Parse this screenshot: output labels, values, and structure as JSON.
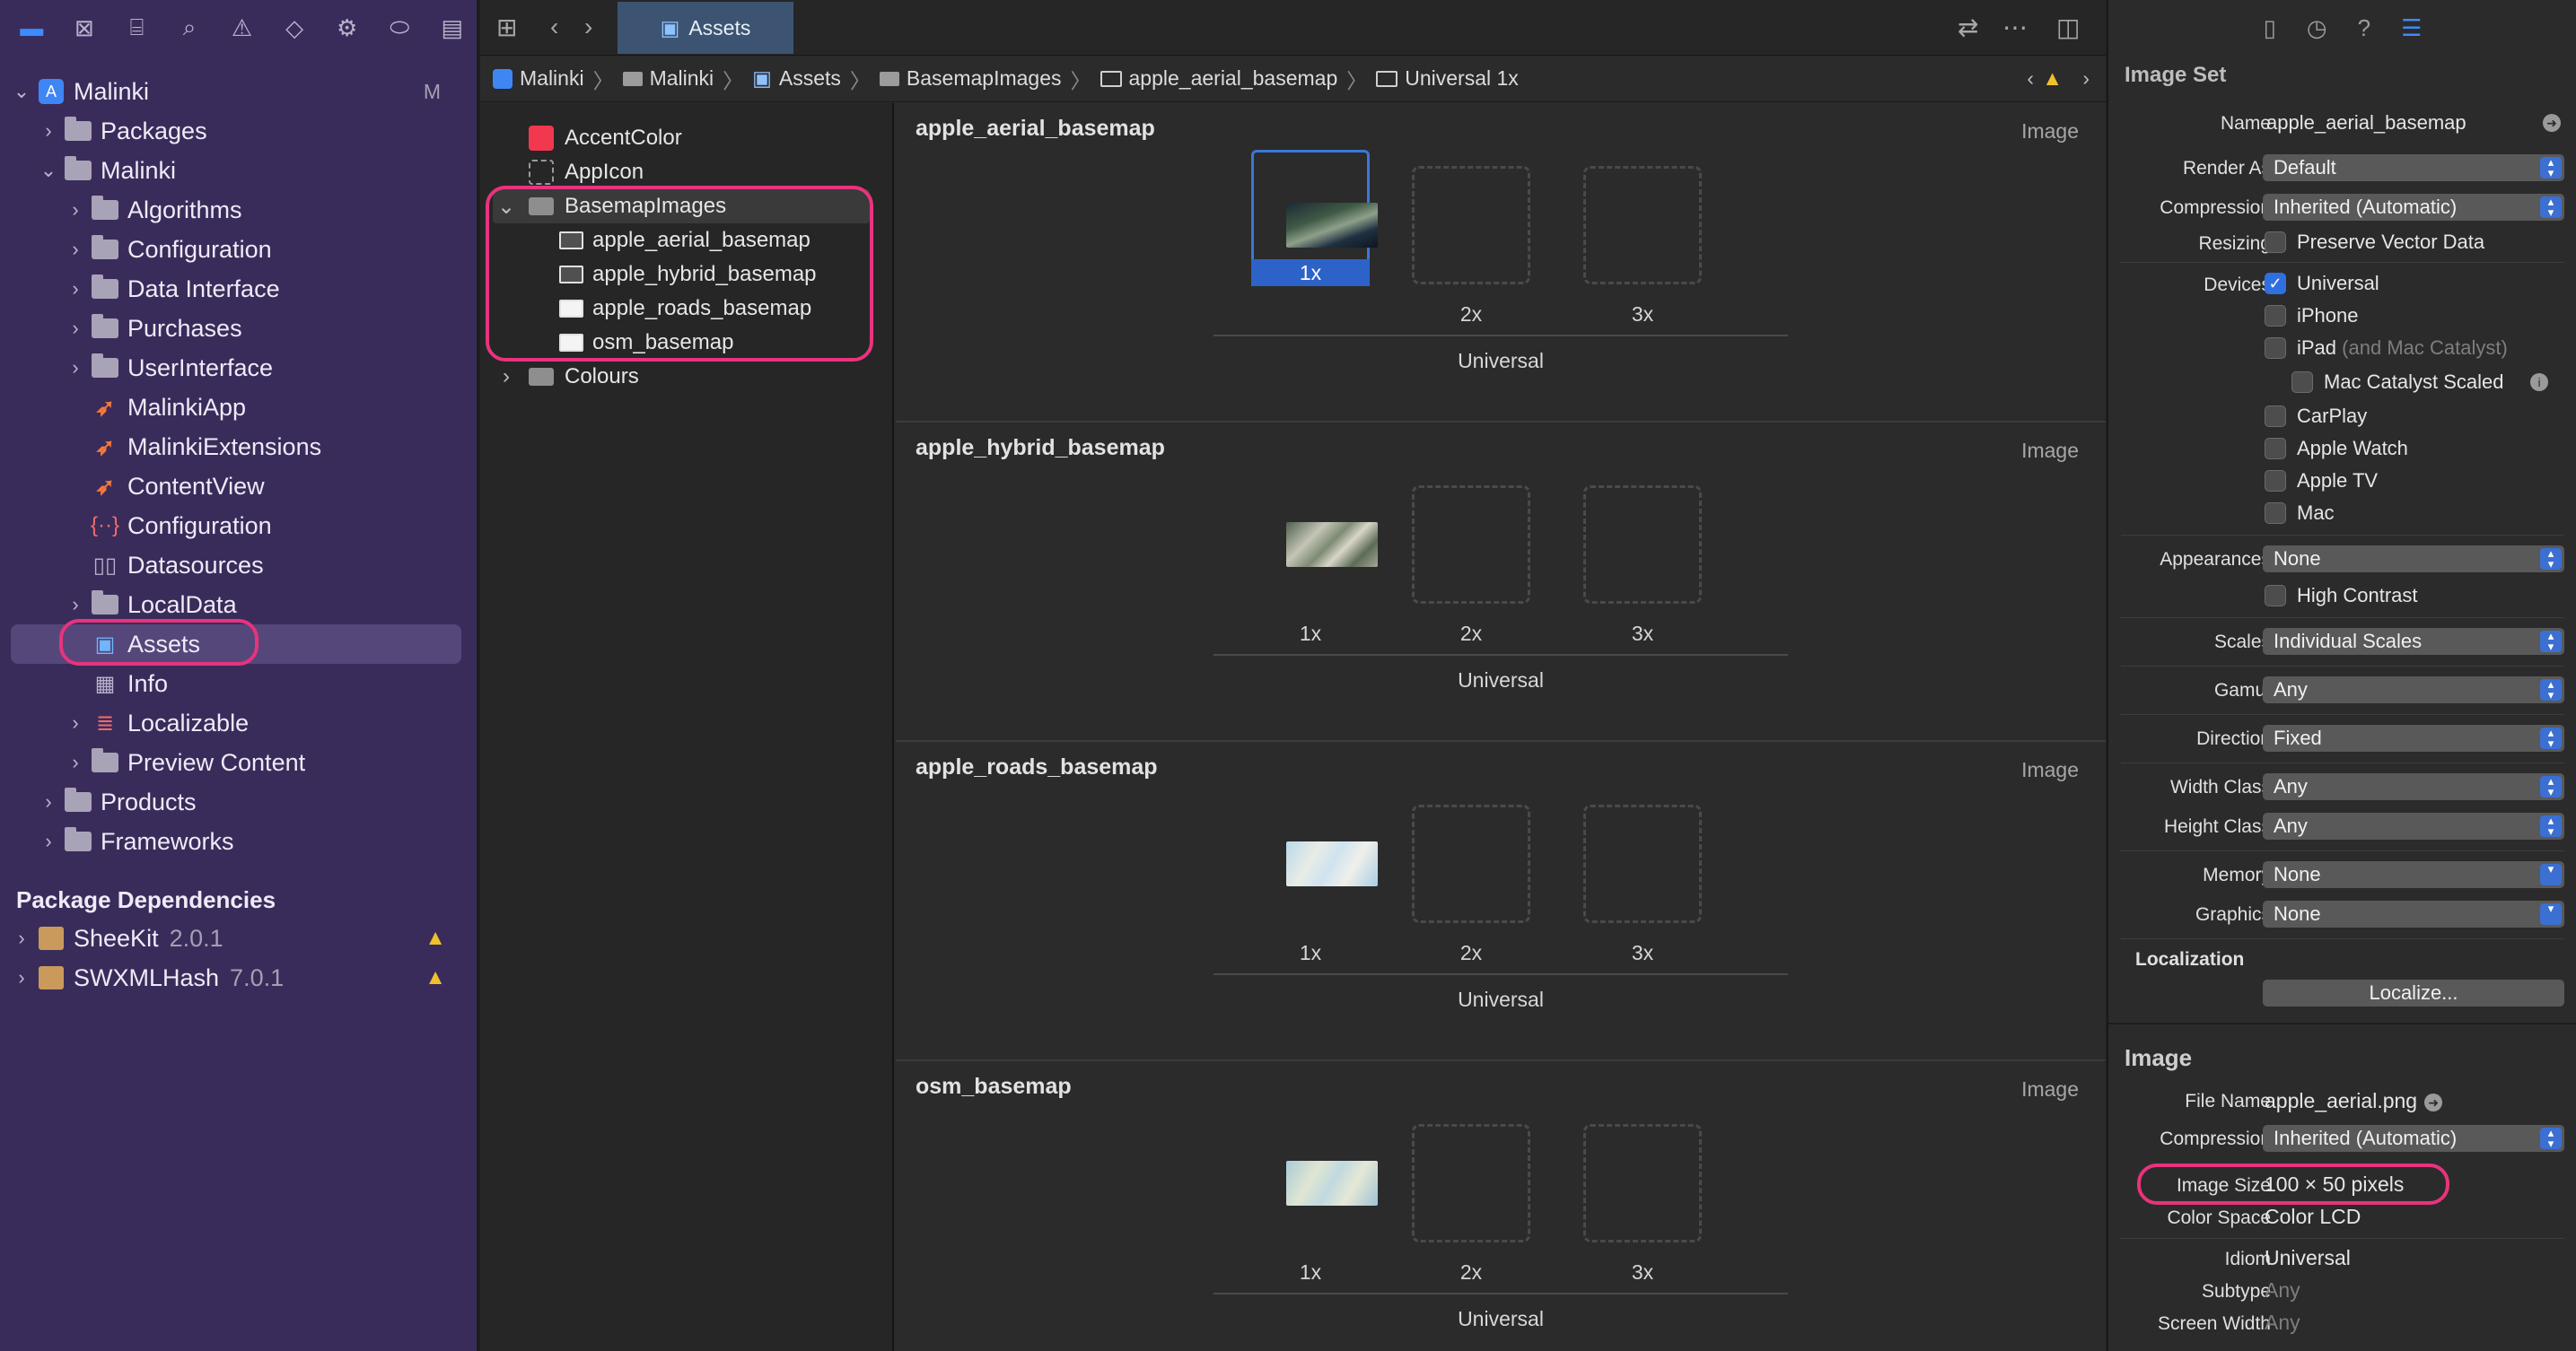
{
  "navigator": {
    "toolbar_icons": [
      "folder-icon",
      "source-control-icon",
      "symbol-icon",
      "search-icon",
      "issue-icon",
      "test-icon",
      "debug-icon",
      "breakpoint-icon",
      "report-icon"
    ],
    "tree": [
      {
        "label": "Malinki",
        "badge": "M",
        "kind": "project"
      },
      {
        "label": "Packages",
        "kind": "folder"
      },
      {
        "label": "Malinki",
        "kind": "folder"
      },
      {
        "label": "Algorithms",
        "kind": "folder"
      },
      {
        "label": "Configuration",
        "kind": "folder"
      },
      {
        "label": "Data Interface",
        "kind": "folder"
      },
      {
        "label": "Purchases",
        "kind": "folder"
      },
      {
        "label": "UserInterface",
        "kind": "folder"
      },
      {
        "label": "MalinkiApp",
        "kind": "swift"
      },
      {
        "label": "MalinkiExtensions",
        "kind": "swift"
      },
      {
        "label": "ContentView",
        "kind": "swift"
      },
      {
        "label": "Configuration",
        "kind": "json"
      },
      {
        "label": "Datasources",
        "kind": "book"
      },
      {
        "label": "LocalData",
        "kind": "folder"
      },
      {
        "label": "Assets",
        "kind": "assets"
      },
      {
        "label": "Info",
        "kind": "plist"
      },
      {
        "label": "Localizable",
        "kind": "strings"
      },
      {
        "label": "Preview Content",
        "kind": "folder"
      },
      {
        "label": "Products",
        "kind": "folder"
      },
      {
        "label": "Frameworks",
        "kind": "folder"
      }
    ],
    "package_dependencies_title": "Package Dependencies",
    "packages": [
      {
        "name": "SheeKit",
        "version": "2.0.1"
      },
      {
        "name": "SWXMLHash",
        "version": "7.0.1"
      }
    ]
  },
  "editor": {
    "tab_label": "Assets",
    "breadcrumbs": [
      "Malinki",
      "Malinki",
      "Assets",
      "BasemapImages",
      "apple_aerial_basemap",
      "Universal 1x"
    ],
    "outline": {
      "accent": "AccentColor",
      "appicon": "AppIcon",
      "group": "BasemapImages",
      "children": [
        "apple_aerial_basemap",
        "apple_hybrid_basemap",
        "apple_roads_basemap",
        "osm_basemap"
      ],
      "colours": "Colours"
    },
    "sets": [
      {
        "name": "apple_aerial_basemap",
        "kind": "Image",
        "scales": [
          "1x",
          "2x",
          "3x"
        ],
        "group": "Universal"
      },
      {
        "name": "apple_hybrid_basemap",
        "kind": "Image",
        "scales": [
          "1x",
          "2x",
          "3x"
        ],
        "group": "Universal"
      },
      {
        "name": "apple_roads_basemap",
        "kind": "Image",
        "scales": [
          "1x",
          "2x",
          "3x"
        ],
        "group": "Universal"
      },
      {
        "name": "osm_basemap",
        "kind": "Image",
        "scales": [
          "1x",
          "2x",
          "3x"
        ],
        "group": "Universal"
      }
    ]
  },
  "inspector": {
    "image_set_title": "Image Set",
    "name_label": "Name",
    "name_value": "apple_aerial_basemap",
    "render_as_label": "Render As",
    "render_as_value": "Default",
    "compression_label": "Compression",
    "compression_value": "Inherited (Automatic)",
    "resizing_label": "Resizing",
    "resizing_value": "Preserve Vector Data",
    "devices_label": "Devices",
    "devices": {
      "universal": "Universal",
      "iphone": "iPhone",
      "ipad": "iPad",
      "ipad_note": "(and Mac Catalyst)",
      "catalyst_scaled": "Mac Catalyst Scaled",
      "carplay": "CarPlay",
      "watch": "Apple Watch",
      "tv": "Apple TV",
      "mac": "Mac"
    },
    "appearances_label": "Appearances",
    "appearances_value": "None",
    "high_contrast": "High Contrast",
    "scales_label": "Scales",
    "scales_value": "Individual Scales",
    "gamut_label": "Gamut",
    "gamut_value": "Any",
    "direction_label": "Direction",
    "direction_value": "Fixed",
    "width_class_label": "Width Class",
    "width_class_value": "Any",
    "height_class_label": "Height Class",
    "height_class_value": "Any",
    "memory_label": "Memory",
    "memory_value": "None",
    "graphics_label": "Graphics",
    "graphics_value": "None",
    "localization_title": "Localization",
    "localize_button": "Localize...",
    "image_title": "Image",
    "file_name_label": "File Name",
    "file_name_value": "apple_aerial.png",
    "img_compression_label": "Compression",
    "img_compression_value": "Inherited (Automatic)",
    "image_size_label": "Image Size",
    "image_size_value": "100 × 50 pixels",
    "color_space_label": "Color Space",
    "color_space_value": "Color LCD",
    "idiom_label": "Idiom",
    "idiom_value": "Universal",
    "subtype_label": "Subtype",
    "subtype_value": "Any",
    "screen_width_label": "Screen Width",
    "screen_width_value": "Any"
  },
  "colors": {
    "sidebar": "#3a2c5a",
    "accent": "#3d8bff",
    "highlight": "#e8337d",
    "accent_color_swatch": "#f2384f"
  }
}
